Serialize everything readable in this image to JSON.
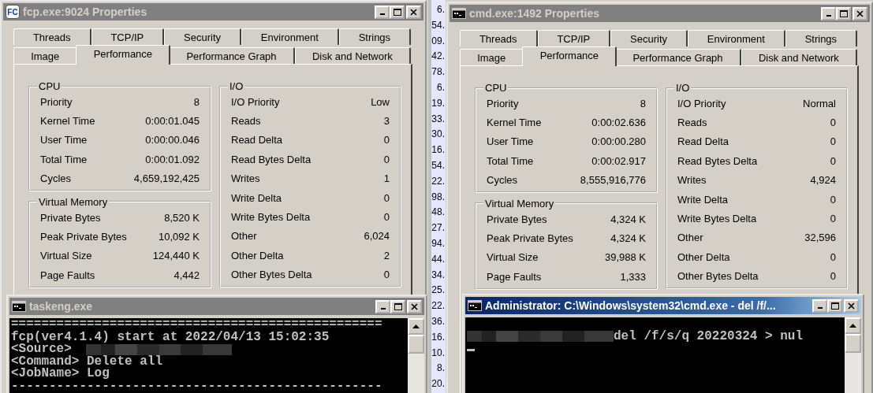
{
  "background_list": {
    "values": [
      "6.",
      "54.",
      "09.",
      "42.",
      "78.",
      "6.",
      "19.",
      "33.",
      "30.",
      "16.",
      "54.",
      "22.",
      "98.",
      "48.",
      "27.",
      "94.",
      "44.",
      "34.",
      "25.",
      "22.",
      "36.",
      "16.",
      "10.",
      "8.",
      "20."
    ]
  },
  "windows": [
    {
      "title": "fcp.exe:9024 Properties",
      "icon_label": "FC",
      "tab_rows": [
        [
          {
            "label": "Threads",
            "selected": false
          },
          {
            "label": "TCP/IP",
            "selected": false
          },
          {
            "label": "Security",
            "selected": false
          },
          {
            "label": "Environment",
            "selected": false
          },
          {
            "label": "Strings",
            "selected": false
          }
        ],
        [
          {
            "label": "Image",
            "selected": false
          },
          {
            "label": "Performance",
            "selected": true
          },
          {
            "label": "Performance Graph",
            "selected": false
          },
          {
            "label": "Disk and Network",
            "selected": false
          }
        ]
      ],
      "cpu": {
        "title": "CPU",
        "rows": [
          {
            "label": "Priority",
            "value": "8"
          },
          {
            "label": "Kernel Time",
            "value": "0:00:01.045"
          },
          {
            "label": "User Time",
            "value": "0:00:00.046"
          },
          {
            "label": "Total Time",
            "value": "0:00:01.092"
          },
          {
            "label": "Cycles",
            "value": "4,659,192,425"
          }
        ]
      },
      "virtual_memory": {
        "title": "Virtual Memory",
        "rows": [
          {
            "label": "Private Bytes",
            "value": "8,520 K"
          },
          {
            "label": "Peak Private Bytes",
            "value": "10,092 K"
          },
          {
            "label": "Virtual Size",
            "value": "124,440 K"
          },
          {
            "label": "Page Faults",
            "value": "4,442"
          }
        ]
      },
      "io": {
        "title": "I/O",
        "rows": [
          {
            "label": "I/O Priority",
            "value": "Low"
          },
          {
            "label": "Reads",
            "value": "3"
          },
          {
            "label": "Read Delta",
            "value": "0"
          },
          {
            "label": "Read Bytes Delta",
            "value": "0"
          },
          {
            "label": "Writes",
            "value": "1"
          },
          {
            "label": "Write Delta",
            "value": "0"
          },
          {
            "label": "Write Bytes Delta",
            "value": "0"
          },
          {
            "label": "Other",
            "value": "6,024"
          },
          {
            "label": "Other Delta",
            "value": "2"
          },
          {
            "label": "Other Bytes Delta",
            "value": "0"
          }
        ]
      }
    },
    {
      "title": "cmd.exe:1492 Properties",
      "tab_rows": [
        [
          {
            "label": "Threads",
            "selected": false
          },
          {
            "label": "TCP/IP",
            "selected": false
          },
          {
            "label": "Security",
            "selected": false
          },
          {
            "label": "Environment",
            "selected": false
          },
          {
            "label": "Strings",
            "selected": false
          }
        ],
        [
          {
            "label": "Image",
            "selected": false
          },
          {
            "label": "Performance",
            "selected": true
          },
          {
            "label": "Performance Graph",
            "selected": false
          },
          {
            "label": "Disk and Network",
            "selected": false
          }
        ]
      ],
      "cpu": {
        "title": "CPU",
        "rows": [
          {
            "label": "Priority",
            "value": "8"
          },
          {
            "label": "Kernel Time",
            "value": "0:00:02.636"
          },
          {
            "label": "User Time",
            "value": "0:00:00.280"
          },
          {
            "label": "Total Time",
            "value": "0:00:02.917"
          },
          {
            "label": "Cycles",
            "value": "8,555,916,776"
          }
        ]
      },
      "virtual_memory": {
        "title": "Virtual Memory",
        "rows": [
          {
            "label": "Private Bytes",
            "value": "4,324 K"
          },
          {
            "label": "Peak Private Bytes",
            "value": "4,324 K"
          },
          {
            "label": "Virtual Size",
            "value": "39,988 K"
          },
          {
            "label": "Page Faults",
            "value": "1,333"
          }
        ]
      },
      "io": {
        "title": "I/O",
        "rows": [
          {
            "label": "I/O Priority",
            "value": "Normal"
          },
          {
            "label": "Reads",
            "value": "0"
          },
          {
            "label": "Read Delta",
            "value": "0"
          },
          {
            "label": "Read Bytes Delta",
            "value": "0"
          },
          {
            "label": "Writes",
            "value": "4,924"
          },
          {
            "label": "Write Delta",
            "value": "0"
          },
          {
            "label": "Write Bytes Delta",
            "value": "0"
          },
          {
            "label": "Other",
            "value": "32,596"
          },
          {
            "label": "Other Delta",
            "value": "0"
          },
          {
            "label": "Other Bytes Delta",
            "value": "0"
          }
        ]
      }
    }
  ],
  "consoles": [
    {
      "title": "taskeng.exe",
      "active": false,
      "lines": [
        {
          "kind": "plain",
          "text": "================================================="
        },
        {
          "kind": "plain",
          "text": "fcp(ver4.1.4) start at 2022/04/13 15:02:35"
        },
        {
          "kind": "redacted_after",
          "text": "<Source>"
        },
        {
          "kind": "plain",
          "text": "<Command> Delete all"
        },
        {
          "kind": "plain",
          "text": "<JobName> Log"
        },
        {
          "kind": "plain",
          "text": "-------------------------------------------------"
        }
      ]
    },
    {
      "title": "Administrator: C:\\Windows\\system32\\cmd.exe - del  /f/...",
      "active": true,
      "lines": [
        {
          "kind": "blank"
        },
        {
          "kind": "redacted_before",
          "text": "del /f/s/q 20220324 > nul"
        },
        {
          "kind": "cursor"
        }
      ]
    }
  ]
}
